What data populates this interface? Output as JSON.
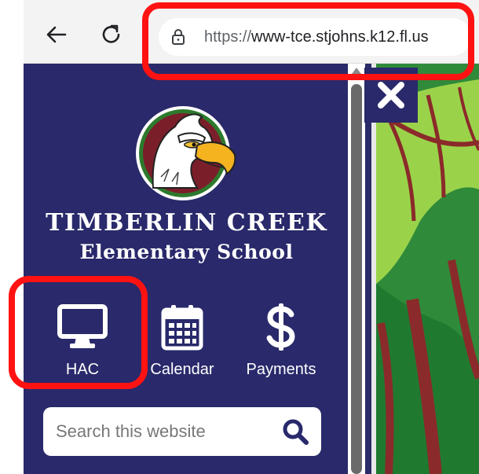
{
  "browser": {
    "url_scheme": "https://",
    "url_host": "www-tce.stjohns.k12.fl.us",
    "icons": [
      "back-arrow-icon",
      "reload-icon",
      "lock-icon"
    ]
  },
  "school": {
    "name_line1": "TIMBERLIN CREEK",
    "name_line2": "Elementary School",
    "logo_icon": "eagle-mascot-logo"
  },
  "quick_links": [
    {
      "label": "HAC",
      "icon": "monitor-icon"
    },
    {
      "label": "Calendar",
      "icon": "calendar-icon"
    },
    {
      "label": "Payments",
      "icon": "dollar-icon"
    }
  ],
  "search": {
    "placeholder": "Search this website",
    "icon": "search-icon"
  },
  "colors": {
    "sidebar": "#29296b",
    "highlight": "#ff1212",
    "hero_green": "#3c8a3a",
    "hero_maroon": "#8b2a2a"
  }
}
